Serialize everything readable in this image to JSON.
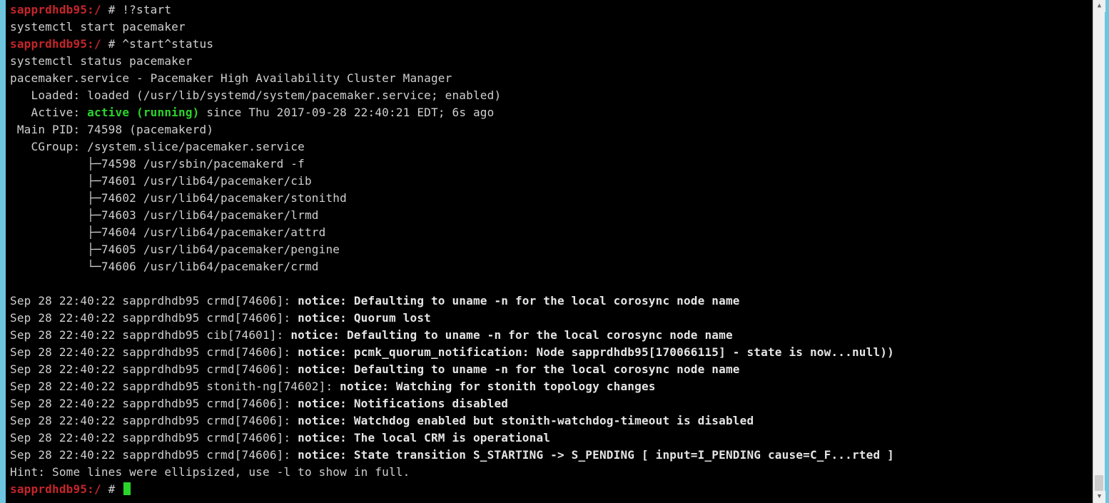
{
  "prompt": {
    "host_path": "sapprdhdb95:/",
    "hash": "#"
  },
  "history": [
    {
      "type": "prompt",
      "input": "!?start"
    },
    {
      "type": "out",
      "text": "systemctl start pacemaker"
    },
    {
      "type": "prompt",
      "input": "^start^status"
    },
    {
      "type": "out",
      "text": "systemctl status pacemaker"
    }
  ],
  "status": {
    "header": "pacemaker.service - Pacemaker High Availability Cluster Manager",
    "loaded_pre": "   Loaded: loaded (/usr/lib/systemd/system/pacemaker.service; enabled)",
    "active_pre": "   Active: ",
    "active_state": "active (running)",
    "active_post": " since Thu 2017-09-28 22:40:21 EDT; 6s ago",
    "main_pid": " Main PID: 74598 (pacemakerd)",
    "cgroup_head": "   CGroup: /system.slice/pacemaker.service",
    "cgroup_lines": [
      "           ├─74598 /usr/sbin/pacemakerd -f",
      "           ├─74601 /usr/lib64/pacemaker/cib",
      "           ├─74602 /usr/lib64/pacemaker/stonithd",
      "           ├─74603 /usr/lib64/pacemaker/lrmd",
      "           ├─74604 /usr/lib64/pacemaker/attrd",
      "           ├─74605 /usr/lib64/pacemaker/pengine",
      "           └─74606 /usr/lib64/pacemaker/crmd"
    ]
  },
  "log_lines": [
    {
      "pre": "Sep 28 22:40:22 sapprdhdb95 crmd[74606]: ",
      "bold": "notice: Defaulting to uname -n for the local corosync node name"
    },
    {
      "pre": "Sep 28 22:40:22 sapprdhdb95 crmd[74606]: ",
      "bold": "notice: Quorum lost"
    },
    {
      "pre": "Sep 28 22:40:22 sapprdhdb95 cib[74601]: ",
      "bold": "notice: Defaulting to uname -n for the local corosync node name"
    },
    {
      "pre": "Sep 28 22:40:22 sapprdhdb95 crmd[74606]: ",
      "bold": "notice: pcmk_quorum_notification: Node sapprdhdb95[170066115] - state is now...null))"
    },
    {
      "pre": "Sep 28 22:40:22 sapprdhdb95 crmd[74606]: ",
      "bold": "notice: Defaulting to uname -n for the local corosync node name"
    },
    {
      "pre": "Sep 28 22:40:22 sapprdhdb95 stonith-ng[74602]: ",
      "bold": "notice: Watching for stonith topology changes"
    },
    {
      "pre": "Sep 28 22:40:22 sapprdhdb95 crmd[74606]: ",
      "bold": "notice: Notifications disabled"
    },
    {
      "pre": "Sep 28 22:40:22 sapprdhdb95 crmd[74606]: ",
      "bold": "notice: Watchdog enabled but stonith-watchdog-timeout is disabled"
    },
    {
      "pre": "Sep 28 22:40:22 sapprdhdb95 crmd[74606]: ",
      "bold": "notice: The local CRM is operational"
    },
    {
      "pre": "Sep 28 22:40:22 sapprdhdb95 crmd[74606]: ",
      "bold": "notice: State transition S_STARTING -> S_PENDING [ input=I_PENDING cause=C_F...rted ]"
    }
  ],
  "hint": "Hint: Some lines were ellipsized, use -l to show in full."
}
